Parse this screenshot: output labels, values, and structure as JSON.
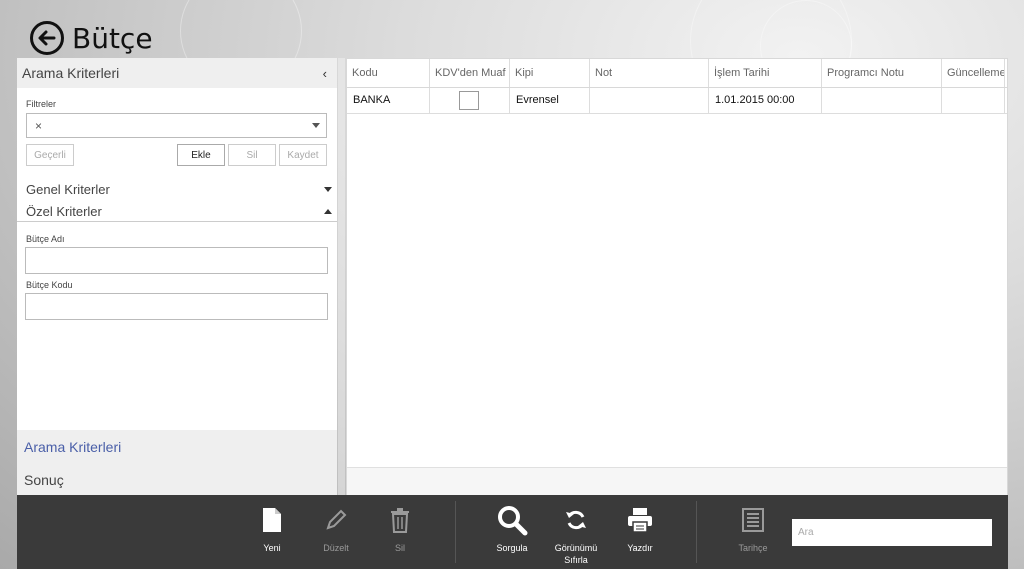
{
  "header": {
    "title": "Bütçe"
  },
  "search_panel": {
    "title": "Arama Kriterleri",
    "collapse_glyph": "‹",
    "filters_label": "Filtreler",
    "filter_value": "×",
    "buttons": {
      "current": "Geçerli",
      "add": "Ekle",
      "delete": "Sil",
      "save": "Kaydet"
    },
    "sections": {
      "general": "Genel Kriterler",
      "special": "Özel Kriterler"
    },
    "fields": {
      "budget_name": {
        "label": "Bütçe Adı",
        "value": ""
      },
      "budget_code": {
        "label": "Bütçe Kodu",
        "value": ""
      }
    },
    "footer": {
      "search_criteria": "Arama Kriterleri",
      "result": "Sonuç"
    }
  },
  "grid": {
    "columns": [
      "Kodu",
      "KDV'den Muaf",
      "Kipi",
      "Not",
      "İşlem Tarihi",
      "Programcı Notu",
      "Güncelleme"
    ],
    "rows": [
      {
        "kodu": "BANKA",
        "kdv_muaf": false,
        "kipi": "Evrensel",
        "not": "",
        "islem_tarihi": "1.01.2015 00:00",
        "programci_notu": "",
        "guncelleme": ""
      }
    ]
  },
  "appbar": {
    "new": "Yeni",
    "edit": "Düzelt",
    "delete": "Sil",
    "query": "Sorgula",
    "reset_view_line1": "Görünümü",
    "reset_view_line2": "Sıfırla",
    "print": "Yazdır",
    "history": "Tarihçe",
    "search_placeholder": "Ara"
  },
  "colors": {
    "accent_link": "#4a5fa8",
    "appbar_bg": "#3a3a3a"
  },
  "icons": [
    "back-arrow-icon",
    "chevron-left-icon",
    "dropdown-caret-icon",
    "document-icon",
    "pencil-icon",
    "trash-icon",
    "magnifier-icon",
    "refresh-icon",
    "printer-icon",
    "history-list-icon"
  ]
}
